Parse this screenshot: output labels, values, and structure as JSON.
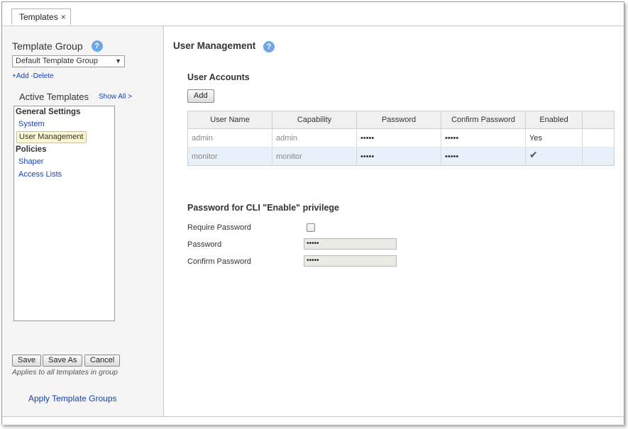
{
  "tab": {
    "label": "Templates",
    "close": "×"
  },
  "sidebar": {
    "template_group_label": "Template Group",
    "help": "?",
    "template_group_value": "Default Template Group",
    "add_label": "+Add",
    "delete_label": "-Delete",
    "active_templates_label": "Active Templates",
    "show_all_label": "Show All >",
    "tree": {
      "general_settings": "General Settings",
      "system": "System",
      "user_management": "User Management",
      "policies": "Policies",
      "shaper": "Shaper",
      "access_lists": "Access Lists"
    },
    "buttons": {
      "save": "Save",
      "save_as": "Save As",
      "cancel": "Cancel"
    },
    "note": "Applies to all templates in group",
    "apply_link": "Apply Template Groups"
  },
  "main": {
    "title": "User Management",
    "help": "?",
    "user_accounts_title": "User Accounts",
    "add_button": "Add",
    "table": {
      "headers": [
        "User Name",
        "Capability",
        "Password",
        "Confirm Password",
        "Enabled",
        ""
      ],
      "rows": [
        {
          "user": "admin",
          "capability": "admin",
          "password": "•••••",
          "confirm": "•••••",
          "enabled": "Yes"
        },
        {
          "user": "monitor",
          "capability": "monitor",
          "password": "•••••",
          "confirm": "•••••",
          "enabled": "✔"
        }
      ]
    },
    "cli_title": "Password for CLI \"Enable\" privilege",
    "require_password_label": "Require Password",
    "password_label": "Password",
    "password_value": "•••••",
    "confirm_password_label": "Confirm Password",
    "confirm_password_value": "•••••"
  }
}
